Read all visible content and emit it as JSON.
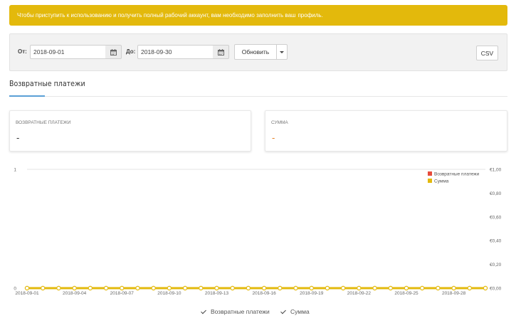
{
  "banner": {
    "text": "Чтобы приступить к использованию и получить полный рабочий аккаунт, вам необходимо заполнить ваш",
    "link": "профиль."
  },
  "filter": {
    "from_label": "От:",
    "from_value": "2018-09-01",
    "to_label": "До:",
    "to_value": "2018-09-30",
    "refresh_label": "Обновить",
    "csv_label": "CSV"
  },
  "section": {
    "title": "Возвратные платежи"
  },
  "cards": [
    {
      "title": "ВОЗВРАТНЫЕ ПЛАТЕЖИ",
      "value": "-"
    },
    {
      "title": "СУММА",
      "value": "-"
    }
  ],
  "colors": {
    "banner": "#e3b90c",
    "series_refunds": "#e74c3c",
    "series_sum": "#e3b90c",
    "accent": "#5a9fd6"
  },
  "chart_data": {
    "type": "line",
    "x": [
      "2018-09-01",
      "2018-09-02",
      "2018-09-03",
      "2018-09-04",
      "2018-09-05",
      "2018-09-06",
      "2018-09-07",
      "2018-09-08",
      "2018-09-09",
      "2018-09-10",
      "2018-09-11",
      "2018-09-12",
      "2018-09-13",
      "2018-09-14",
      "2018-09-15",
      "2018-09-16",
      "2018-09-17",
      "2018-09-18",
      "2018-09-19",
      "2018-09-20",
      "2018-09-21",
      "2018-09-22",
      "2018-09-23",
      "2018-09-24",
      "2018-09-25",
      "2018-09-26",
      "2018-09-27",
      "2018-09-28",
      "2018-09-29",
      "2018-09-30"
    ],
    "x_tick_labels": [
      "2018-09-01",
      "2018-09-04",
      "2018-09-07",
      "2018-09-10",
      "2018-09-13",
      "2018-09-16",
      "2018-09-19",
      "2018-09-22",
      "2018-09-25",
      "2018-09-28"
    ],
    "series": [
      {
        "name": "Возвратные платежи",
        "axis": "left",
        "values": [
          0,
          0,
          0,
          0,
          0,
          0,
          0,
          0,
          0,
          0,
          0,
          0,
          0,
          0,
          0,
          0,
          0,
          0,
          0,
          0,
          0,
          0,
          0,
          0,
          0,
          0,
          0,
          0,
          0,
          0
        ]
      },
      {
        "name": "Сумма",
        "axis": "right",
        "values": [
          0,
          0,
          0,
          0,
          0,
          0,
          0,
          0,
          0,
          0,
          0,
          0,
          0,
          0,
          0,
          0,
          0,
          0,
          0,
          0,
          0,
          0,
          0,
          0,
          0,
          0,
          0,
          0,
          0,
          0
        ]
      }
    ],
    "y_left": {
      "range": [
        0,
        1
      ],
      "tick_labels": [
        "0",
        "1"
      ]
    },
    "y_right": {
      "range": [
        0,
        1
      ],
      "tick_labels": [
        "€0,00",
        "€0,20",
        "€0,40",
        "€0,60",
        "€0,80",
        "€1,00"
      ]
    },
    "legend_position": "top-right",
    "bottom_toggles": [
      "Возвратные платежи",
      "Сумма"
    ]
  }
}
